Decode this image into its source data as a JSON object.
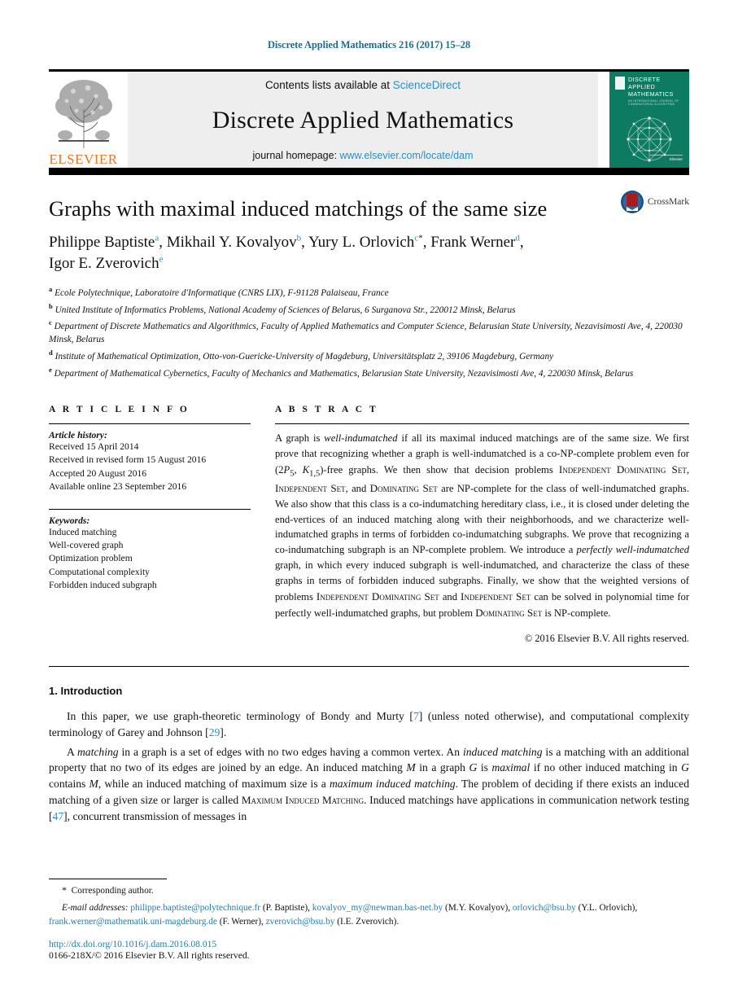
{
  "running_head": "Discrete Applied Mathematics 216 (2017) 15–28",
  "masthead": {
    "contents_prefix": "Contents lists available at ",
    "sciencedirect": "ScienceDirect",
    "journal_name": "Discrete Applied Mathematics",
    "homepage_prefix": "journal homepage: ",
    "homepage_url": "www.elsevier.com/locate/dam",
    "publisher_wordmark": "ELSEVIER",
    "cover": {
      "line1": "DISCRETE",
      "line2": "APPLIED",
      "line3": "MATHEMATICS",
      "subtitle": "AN INTERNATIONAL JOURNAL OF COMBINATORIAL ALGORITHMS",
      "footer": "Elsevier"
    }
  },
  "article": {
    "title": "Graphs with maximal induced matchings of the same size",
    "crossmark_label": "CrossMark",
    "authors_line1": "Philippe Baptiste",
    "authors_html_note": "rendered in template with superscripts",
    "authors": [
      {
        "name": "Philippe Baptiste",
        "mark": "a",
        "sep": ", "
      },
      {
        "name": "Mikhail Y. Kovalyov",
        "mark": "b",
        "sep": ", "
      },
      {
        "name": "Yury L. Orlovich",
        "mark": "c",
        "star": "*",
        "sep": ", "
      },
      {
        "name": "Frank Werner",
        "mark": "d",
        "sep": ", "
      },
      {
        "name": "Igor E. Zverovich",
        "mark": "e",
        "sep": ""
      }
    ],
    "affiliations": [
      {
        "mark": "a",
        "text": "Ecole Polytechnique, Laboratoire d'Informatique (CNRS LIX), F-91128 Palaiseau, France"
      },
      {
        "mark": "b",
        "text": "United Institute of Informatics Problems, National Academy of Sciences of Belarus, 6 Surganova Str., 220012 Minsk, Belarus"
      },
      {
        "mark": "c",
        "text": "Department of Discrete Mathematics and Algorithmics, Faculty of Applied Mathematics and Computer Science, Belarusian State University, Nezavisimosti Ave, 4, 220030 Minsk, Belarus"
      },
      {
        "mark": "d",
        "text": "Institute of Mathematical Optimization, Otto-von-Guericke-University of Magdeburg, Universitätsplatz 2, 39106 Magdeburg, Germany"
      },
      {
        "mark": "e",
        "text": "Department of Mathematical Cybernetics, Faculty of Mechanics and Mathematics, Belarusian State University, Nezavisimosti Ave, 4, 220030 Minsk, Belarus"
      }
    ]
  },
  "article_info": {
    "heading": "A R T I C L E     I N F O",
    "history_label": "Article history:",
    "history": [
      "Received 15 April 2014",
      "Received in revised form 15 August 2016",
      "Accepted 20 August 2016",
      "Available online 23 September 2016"
    ],
    "keywords_label": "Keywords:",
    "keywords": [
      "Induced matching",
      "Well-covered graph",
      "Optimization problem",
      "Computational complexity",
      "Forbidden induced subgraph"
    ]
  },
  "abstract": {
    "heading": "A B S T R A C T",
    "copyright": "© 2016 Elsevier B.V. All rights reserved."
  },
  "introduction": {
    "heading": "1.  Introduction",
    "ref_bondy": "7",
    "ref_garey": "29",
    "ref_network": "47"
  },
  "footnotes": {
    "corresponding": "Corresponding author.",
    "email_label": "E-mail addresses:",
    "emails": [
      {
        "address": "philippe.baptiste@polytechnique.fr",
        "who": "(P. Baptiste)"
      },
      {
        "address": "kovalyov_my@newman.bas-net.by",
        "who": "(M.Y. Kovalyov)"
      },
      {
        "address": "orlovich@bsu.by",
        "who": "(Y.L. Orlovich)"
      },
      {
        "address": "frank.werner@mathematik.uni-magdeburg.de",
        "who": "(F. Werner)"
      },
      {
        "address": "zverovich@bsu.by",
        "who": "(I.E. Zverovich)"
      }
    ],
    "doi": "http://dx.doi.org/10.1016/j.dam.2016.08.015",
    "issn": "0166-218X/© 2016 Elsevier B.V. All rights reserved."
  },
  "colors": {
    "link": "#2b8fc4",
    "running_head": "#1f6f8b",
    "elsevier_orange": "#E87722",
    "cover_green": "#0d7a62",
    "crossmark_red": "#b52025"
  }
}
